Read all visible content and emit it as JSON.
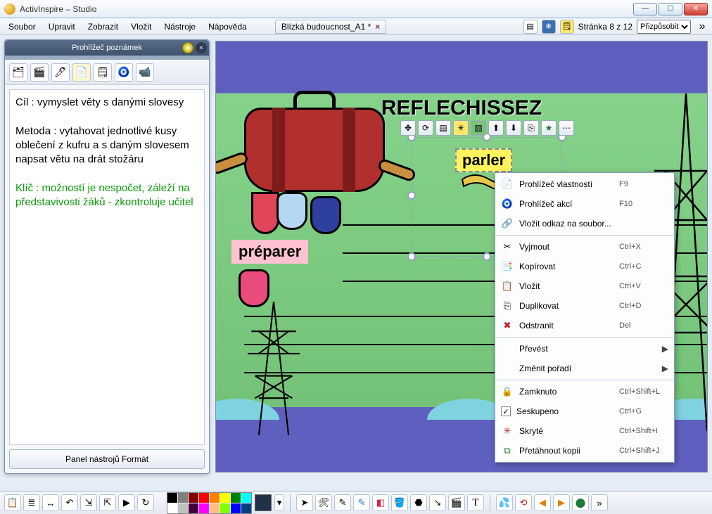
{
  "app": {
    "title": "ActivInspire – Studio"
  },
  "menu": {
    "items": [
      "Soubor",
      "Upravit",
      "Zobrazit",
      "Vložit",
      "Nástroje",
      "Nápověda"
    ]
  },
  "tab": {
    "label": "Blízká budoucnost_A1 *",
    "dirty": true
  },
  "pager": {
    "text": "Stránka 8 z 12",
    "zoom_label": "Přizpůsobit"
  },
  "notes_panel": {
    "title": "Prohlížeč poznámek",
    "body_black_1": "Cíl : vymyslet věty s danými slovesy",
    "body_black_2": "Metoda : vytahovat jednotlivé kusy oblečení z kufru a s daným slovesem napsat větu na drát stožáru",
    "body_green": "Klíč : možností je nespočet, záleží na představivosti žáků - zkontroluje učitel",
    "footer": "Panel nástrojů Formát"
  },
  "canvas": {
    "heading": "REFLECHISSEZ",
    "stickers": {
      "preparer": "préparer",
      "parler": "parler"
    }
  },
  "context_menu": {
    "items": [
      {
        "icon": "📄",
        "label": "Prohlížeč vlastností",
        "shortcut": "F9"
      },
      {
        "icon": "🧿",
        "label": "Prohlížeč akcí",
        "shortcut": "F10"
      },
      {
        "icon": "🔗",
        "label": "Vložit odkaz na soubor...",
        "shortcut": ""
      },
      {
        "sep": true
      },
      {
        "icon": "✂",
        "label": "Vyjmout",
        "shortcut": "Ctrl+X"
      },
      {
        "icon": "📑",
        "label": "Kopírovat",
        "shortcut": "Ctrl+C"
      },
      {
        "icon": "📋",
        "label": "Vložit",
        "shortcut": "Ctrl+V"
      },
      {
        "icon": "⎘",
        "label": "Duplikovat",
        "shortcut": "Ctrl+D"
      },
      {
        "icon": "✖",
        "label": "Odstranit",
        "shortcut": "Del",
        "iconColor": "#c02020"
      },
      {
        "sep": true
      },
      {
        "icon": "",
        "label": "Převést",
        "submenu": true
      },
      {
        "icon": "",
        "label": "Změnit pořadí",
        "submenu": true
      },
      {
        "sep": true
      },
      {
        "icon": "🔒",
        "label": "Zamknuto",
        "shortcut": "Ctrl+Shift+L"
      },
      {
        "check": true,
        "label": "Seskupeno",
        "shortcut": "Ctrl+G"
      },
      {
        "icon": "✳",
        "label": "Skryté",
        "shortcut": "Ctrl+Shift+I",
        "iconColor": "#c02020"
      },
      {
        "icon": "⧉",
        "label": "Přetáhnout kopii",
        "shortcut": "Ctrl+Shift+J",
        "iconColor": "#1a7a3a"
      }
    ]
  },
  "palette_colors": [
    "#000000",
    "#808080",
    "#800000",
    "#ff0000",
    "#ff8000",
    "#ffff00",
    "#008000",
    "#00ffff",
    "#ffffff",
    "#c0c0c0",
    "#400040",
    "#ff00ff",
    "#ffc080",
    "#80ff00",
    "#0000ff",
    "#004080"
  ],
  "bottom_tools": [
    "⮌",
    "≣",
    "↔",
    "⤴",
    "⎙",
    "⏵",
    "↻",
    "",
    "",
    "",
    "",
    "",
    "",
    "",
    "",
    "",
    "",
    "",
    ""
  ]
}
